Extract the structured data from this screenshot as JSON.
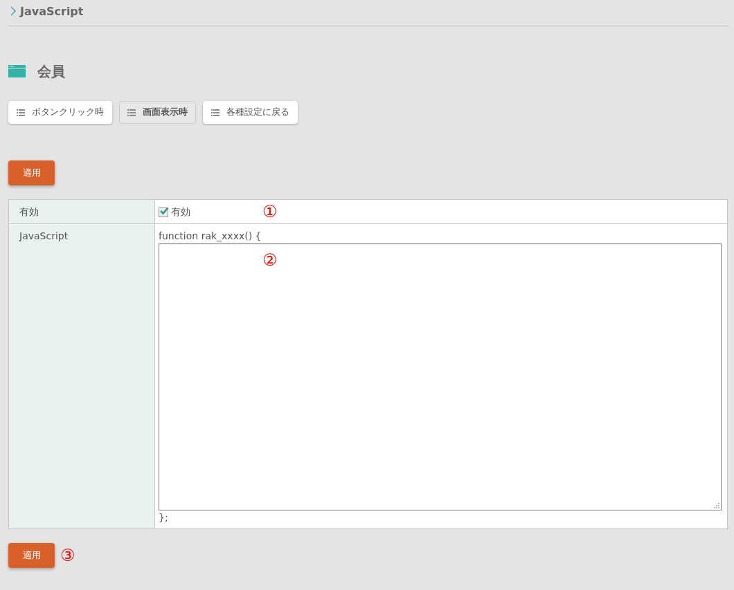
{
  "breadcrumb": {
    "label": "JavaScript"
  },
  "page_title": "会員",
  "tabs": [
    {
      "label": "ボタンクリック時",
      "selected": false
    },
    {
      "label": "画面表示時",
      "selected": true
    },
    {
      "label": "各種設定に戻る",
      "selected": false
    }
  ],
  "apply_button_top": "適用",
  "form": {
    "enabled_row": {
      "label": "有効",
      "checkbox_label": "有効",
      "checked": true,
      "annotation": "①"
    },
    "script_row": {
      "label": "JavaScript",
      "prefix": "function rak_xxxx() {",
      "suffix": "};",
      "annotation": "②"
    }
  },
  "apply_button_bottom": "適用",
  "bottom_annotation": "③"
}
